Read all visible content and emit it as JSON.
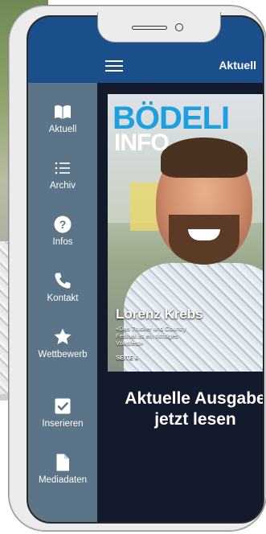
{
  "header": {
    "title": "Aktuell"
  },
  "sidebar": {
    "items": [
      {
        "label": "Aktuell",
        "icon": "book-open-icon"
      },
      {
        "label": "Archiv",
        "icon": "list-icon"
      },
      {
        "label": "Infos",
        "icon": "question-circle-icon"
      },
      {
        "label": "Kontakt",
        "icon": "phone-icon"
      },
      {
        "label": "Wettbewerb",
        "icon": "star-icon"
      },
      {
        "label": "Inserieren",
        "icon": "checkbox-icon"
      },
      {
        "label": "Mediadaten",
        "icon": "document-icon"
      }
    ]
  },
  "cover": {
    "title_top": "BÖDELI",
    "title_bottom": "INFO",
    "name": "Lorenz Krebs",
    "quote": "«Das Trucker und Country Festival ist ein richtiges Volksfest»",
    "page": "SEITE 6"
  },
  "main": {
    "caption_line1": "Aktuelle Ausgabe",
    "caption_line2": "jetzt lesen"
  },
  "colors": {
    "header": "#1b4f8c",
    "sidebar": "#5b7488",
    "content": "#131a2b",
    "accent": "#1e9fe0"
  }
}
